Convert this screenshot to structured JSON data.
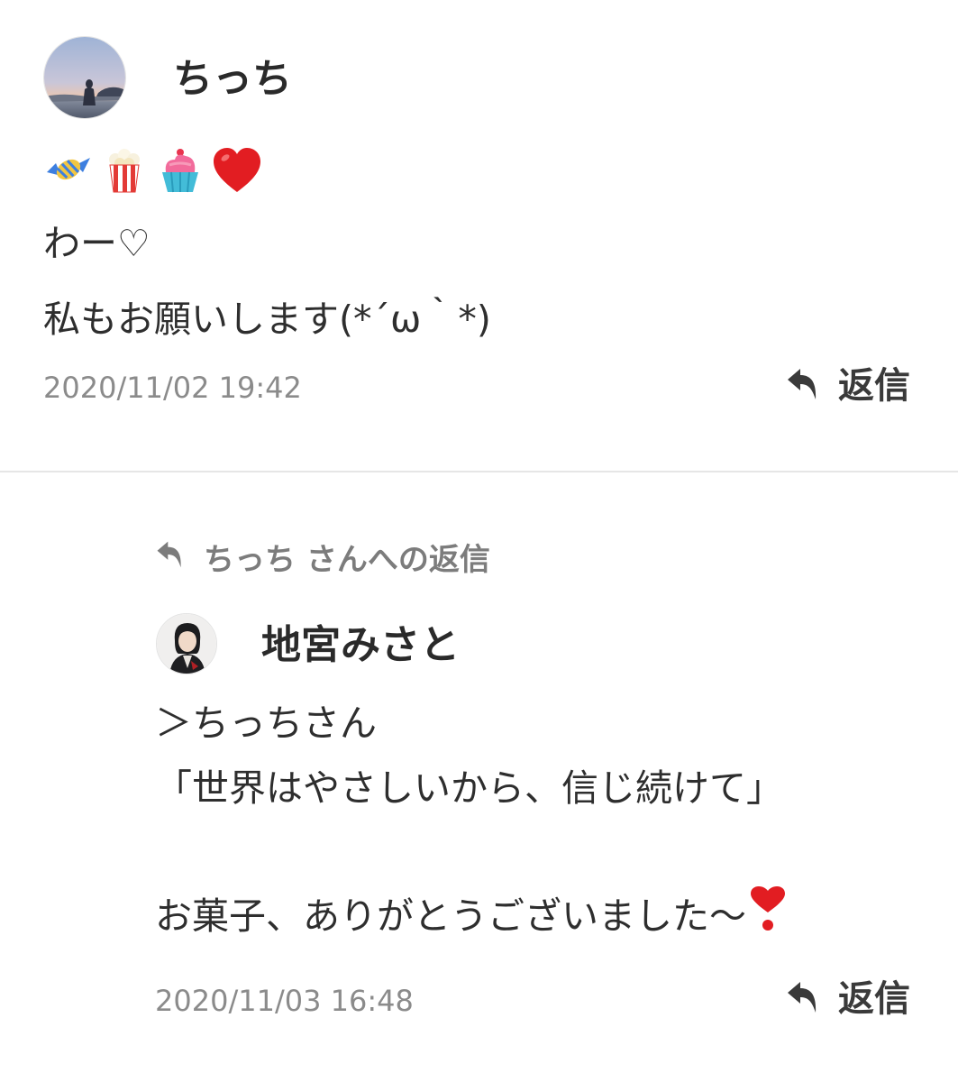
{
  "comment": {
    "username": "ちっち",
    "avatar_icon": "user-avatar-beach-icon",
    "emojis": [
      "candy-emoji",
      "popcorn-emoji",
      "cupcake-emoji",
      "red-heart-emoji"
    ],
    "lines": [
      "わー♡",
      "私もお願いします(*´ω｀*)"
    ],
    "timestamp": "2020/11/02 19:42",
    "reply_label": "返信"
  },
  "reply": {
    "reply_to_label": "ちっち さんへの返信",
    "username": "地宮みさと",
    "avatar_icon": "user-avatar-portrait-icon",
    "lines": [
      "＞ちっちさん",
      "「世界はやさしいから、信じ続けて」",
      "",
      "お菓子、ありがとうございました〜"
    ],
    "trailing_emoji": "heavy-exclamation-heart-emoji",
    "timestamp": "2020/11/03 16:48",
    "reply_label": "返信"
  },
  "colors": {
    "text": "#2c2c2c",
    "meta": "#8b8b8b",
    "divider": "#e6e6e6"
  }
}
